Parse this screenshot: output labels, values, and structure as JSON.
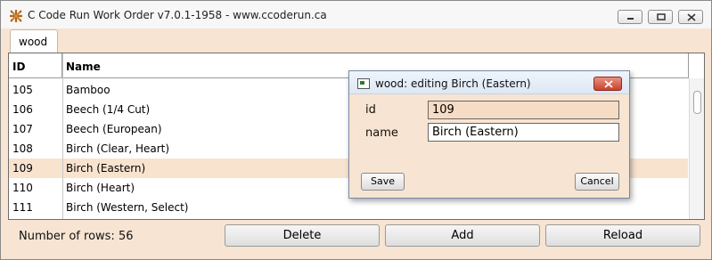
{
  "window": {
    "title": "C Code Run Work Order v7.0.1-1958 - www.ccoderun.ca",
    "icons": {
      "app": "app-icon",
      "minimize": "minimize-icon",
      "maximize": "maximize-icon",
      "close": "close-icon"
    }
  },
  "tabs": [
    {
      "label": "wood",
      "active": true
    }
  ],
  "table": {
    "columns": {
      "id": "ID",
      "name": "Name"
    },
    "rows": [
      {
        "id": "105",
        "name": "Bamboo"
      },
      {
        "id": "106",
        "name": "Beech (1/4 Cut)"
      },
      {
        "id": "107",
        "name": "Beech (European)"
      },
      {
        "id": "108",
        "name": "Birch (Clear, Heart)"
      },
      {
        "id": "109",
        "name": "Birch (Eastern)"
      },
      {
        "id": "110",
        "name": "Birch (Heart)"
      },
      {
        "id": "111",
        "name": "Birch (Western, Select)"
      }
    ],
    "selected_id": "109"
  },
  "footer": {
    "row_count": "Number of rows: 56",
    "delete_label": "Delete",
    "add_label": "Add",
    "reload_label": "Reload"
  },
  "dialog": {
    "title": "wood: editing Birch (Eastern)",
    "fields": [
      {
        "label": "id",
        "value": "109",
        "readonly": true
      },
      {
        "label": "name",
        "value": "Birch (Eastern)",
        "readonly": false
      }
    ],
    "save_label": "Save",
    "cancel_label": "Cancel"
  },
  "colors": {
    "background": "#f7e4d2",
    "selected_row": "#f8e3cf",
    "close_button": "#c9412c"
  }
}
